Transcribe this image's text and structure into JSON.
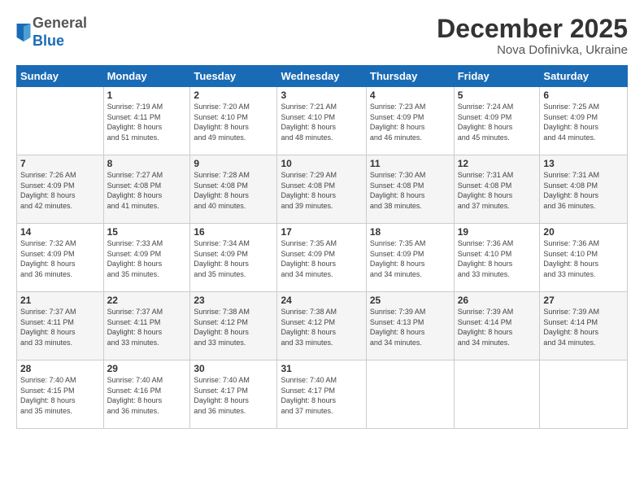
{
  "logo": {
    "general": "General",
    "blue": "Blue"
  },
  "header": {
    "month": "December 2025",
    "location": "Nova Dofinivka, Ukraine"
  },
  "weekdays": [
    "Sunday",
    "Monday",
    "Tuesday",
    "Wednesday",
    "Thursday",
    "Friday",
    "Saturday"
  ],
  "weeks": [
    [
      {
        "day": "",
        "info": ""
      },
      {
        "day": "1",
        "info": "Sunrise: 7:19 AM\nSunset: 4:11 PM\nDaylight: 8 hours\nand 51 minutes."
      },
      {
        "day": "2",
        "info": "Sunrise: 7:20 AM\nSunset: 4:10 PM\nDaylight: 8 hours\nand 49 minutes."
      },
      {
        "day": "3",
        "info": "Sunrise: 7:21 AM\nSunset: 4:10 PM\nDaylight: 8 hours\nand 48 minutes."
      },
      {
        "day": "4",
        "info": "Sunrise: 7:23 AM\nSunset: 4:09 PM\nDaylight: 8 hours\nand 46 minutes."
      },
      {
        "day": "5",
        "info": "Sunrise: 7:24 AM\nSunset: 4:09 PM\nDaylight: 8 hours\nand 45 minutes."
      },
      {
        "day": "6",
        "info": "Sunrise: 7:25 AM\nSunset: 4:09 PM\nDaylight: 8 hours\nand 44 minutes."
      }
    ],
    [
      {
        "day": "7",
        "info": "Sunrise: 7:26 AM\nSunset: 4:09 PM\nDaylight: 8 hours\nand 42 minutes."
      },
      {
        "day": "8",
        "info": "Sunrise: 7:27 AM\nSunset: 4:08 PM\nDaylight: 8 hours\nand 41 minutes."
      },
      {
        "day": "9",
        "info": "Sunrise: 7:28 AM\nSunset: 4:08 PM\nDaylight: 8 hours\nand 40 minutes."
      },
      {
        "day": "10",
        "info": "Sunrise: 7:29 AM\nSunset: 4:08 PM\nDaylight: 8 hours\nand 39 minutes."
      },
      {
        "day": "11",
        "info": "Sunrise: 7:30 AM\nSunset: 4:08 PM\nDaylight: 8 hours\nand 38 minutes."
      },
      {
        "day": "12",
        "info": "Sunrise: 7:31 AM\nSunset: 4:08 PM\nDaylight: 8 hours\nand 37 minutes."
      },
      {
        "day": "13",
        "info": "Sunrise: 7:31 AM\nSunset: 4:08 PM\nDaylight: 8 hours\nand 36 minutes."
      }
    ],
    [
      {
        "day": "14",
        "info": "Sunrise: 7:32 AM\nSunset: 4:09 PM\nDaylight: 8 hours\nand 36 minutes."
      },
      {
        "day": "15",
        "info": "Sunrise: 7:33 AM\nSunset: 4:09 PM\nDaylight: 8 hours\nand 35 minutes."
      },
      {
        "day": "16",
        "info": "Sunrise: 7:34 AM\nSunset: 4:09 PM\nDaylight: 8 hours\nand 35 minutes."
      },
      {
        "day": "17",
        "info": "Sunrise: 7:35 AM\nSunset: 4:09 PM\nDaylight: 8 hours\nand 34 minutes."
      },
      {
        "day": "18",
        "info": "Sunrise: 7:35 AM\nSunset: 4:09 PM\nDaylight: 8 hours\nand 34 minutes."
      },
      {
        "day": "19",
        "info": "Sunrise: 7:36 AM\nSunset: 4:10 PM\nDaylight: 8 hours\nand 33 minutes."
      },
      {
        "day": "20",
        "info": "Sunrise: 7:36 AM\nSunset: 4:10 PM\nDaylight: 8 hours\nand 33 minutes."
      }
    ],
    [
      {
        "day": "21",
        "info": "Sunrise: 7:37 AM\nSunset: 4:11 PM\nDaylight: 8 hours\nand 33 minutes."
      },
      {
        "day": "22",
        "info": "Sunrise: 7:37 AM\nSunset: 4:11 PM\nDaylight: 8 hours\nand 33 minutes."
      },
      {
        "day": "23",
        "info": "Sunrise: 7:38 AM\nSunset: 4:12 PM\nDaylight: 8 hours\nand 33 minutes."
      },
      {
        "day": "24",
        "info": "Sunrise: 7:38 AM\nSunset: 4:12 PM\nDaylight: 8 hours\nand 33 minutes."
      },
      {
        "day": "25",
        "info": "Sunrise: 7:39 AM\nSunset: 4:13 PM\nDaylight: 8 hours\nand 34 minutes."
      },
      {
        "day": "26",
        "info": "Sunrise: 7:39 AM\nSunset: 4:14 PM\nDaylight: 8 hours\nand 34 minutes."
      },
      {
        "day": "27",
        "info": "Sunrise: 7:39 AM\nSunset: 4:14 PM\nDaylight: 8 hours\nand 34 minutes."
      }
    ],
    [
      {
        "day": "28",
        "info": "Sunrise: 7:40 AM\nSunset: 4:15 PM\nDaylight: 8 hours\nand 35 minutes."
      },
      {
        "day": "29",
        "info": "Sunrise: 7:40 AM\nSunset: 4:16 PM\nDaylight: 8 hours\nand 36 minutes."
      },
      {
        "day": "30",
        "info": "Sunrise: 7:40 AM\nSunset: 4:17 PM\nDaylight: 8 hours\nand 36 minutes."
      },
      {
        "day": "31",
        "info": "Sunrise: 7:40 AM\nSunset: 4:17 PM\nDaylight: 8 hours\nand 37 minutes."
      },
      {
        "day": "",
        "info": ""
      },
      {
        "day": "",
        "info": ""
      },
      {
        "day": "",
        "info": ""
      }
    ]
  ]
}
